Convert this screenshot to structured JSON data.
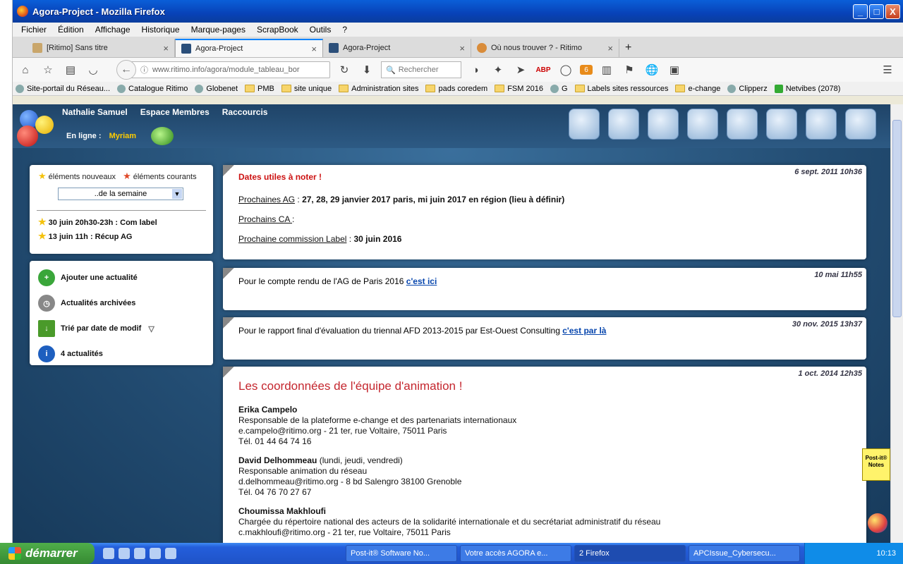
{
  "window": {
    "title": "Agora-Project - Mozilla Firefox",
    "min": "_",
    "max": "□",
    "close": "X"
  },
  "menu": [
    "Fichier",
    "Édition",
    "Affichage",
    "Historique",
    "Marque-pages",
    "ScrapBook",
    "Outils",
    "?"
  ],
  "tabs": [
    {
      "label": "[Ritimo] Sans titre"
    },
    {
      "label": "Agora-Project"
    },
    {
      "label": "Agora-Project"
    },
    {
      "label": "Où nous trouver ? - Ritimo"
    }
  ],
  "newtab": "+",
  "nav": {
    "url": "www.ritimo.info/agora/module_tableau_bor",
    "search_placeholder": "Rechercher",
    "badge": "6"
  },
  "bookmarks": [
    "Site-portail du Réseau...",
    "Catalogue Ritimo",
    "Globenet",
    "PMB",
    "site unique",
    "Administration sites",
    "pads coredem",
    "FSM 2016",
    "G",
    "Labels sites ressources",
    "e-change",
    "Clipperz",
    "Netvibes (2078)"
  ],
  "agora": {
    "user": "Nathalie Samuel",
    "espace": "Espace Membres",
    "raccourcis": "Raccourcis",
    "online_label": "En ligne :",
    "online_user": "Myriam"
  },
  "left": {
    "legend_new": "éléments nouveaux",
    "legend_current": "éléments courants",
    "period": "..de la semaine",
    "events": [
      "30 juin 20h30-23h : Com label",
      "13 juin 11h : Récup AG"
    ],
    "actions": [
      "Ajouter une actualité",
      "Actualités archivées",
      "Trié par date de modif",
      "4 actualités"
    ]
  },
  "news": [
    {
      "date": "6 sept. 2011 10h36",
      "title": "Dates utiles à noter !",
      "l1a": "Prochaines AG",
      "l1b": " : ",
      "l1c": "27, 28, 29 janvier 2017 paris, mi juin 2017 en région (lieu à définir)",
      "l2a": "Prochains CA ",
      "l2b": " :",
      "l3a": "Prochaine commission Label",
      "l3b": " : ",
      "l3c": "30 juin 2016"
    },
    {
      "date": "10 mai 11h55",
      "text": "Pour le compte rendu de l'AG de Paris 2016 ",
      "link": "c'est ici"
    },
    {
      "date": "30 nov. 2015 13h37",
      "text": "Pour le rapport final d'évaluation du triennal AFD 2013-2015 par Est-Ouest Consulting ",
      "link": "c'est par là"
    },
    {
      "date": "1 oct. 2014 12h35",
      "title": "Les coordonnées de l'équipe d'animation !",
      "people": [
        {
          "name": "Erika Campelo",
          "extra": "",
          "role": "Responsable de la plateforme e-change et des partenariats internationaux",
          "addr": "e.campelo@ritimo.org - 21 ter, rue Voltaire, 75011 Paris",
          "tel": "Tél. 01 44 64 74 16"
        },
        {
          "name": "David Delhommeau",
          "extra": " (lundi, jeudi, vendredi)",
          "role": "Responsable animation du réseau",
          "addr": "d.delhommeau@ritimo.org - 8 bd Salengro 38100 Grenoble",
          "tel": "Tél. 04 76 70 27 67"
        },
        {
          "name": "Choumissa Makhloufi",
          "extra": "",
          "role": "Chargée du répertoire national des acteurs de la solidarité internationale et du secrétariat administratif du réseau",
          "addr": "c.makhloufi@ritimo.org - 21 ter, rue Voltaire, 75011 Paris",
          "tel": ""
        }
      ]
    }
  ],
  "postit": {
    "line1": "Post-it®",
    "line2": "Notes"
  },
  "taskbar": {
    "start": "démarrer",
    "tasks": [
      "Post-it® Software No...",
      "Votre accès AGORA e...",
      "2 Firefox",
      "APCIssue_Cybersecu..."
    ],
    "clock": "10:13"
  }
}
